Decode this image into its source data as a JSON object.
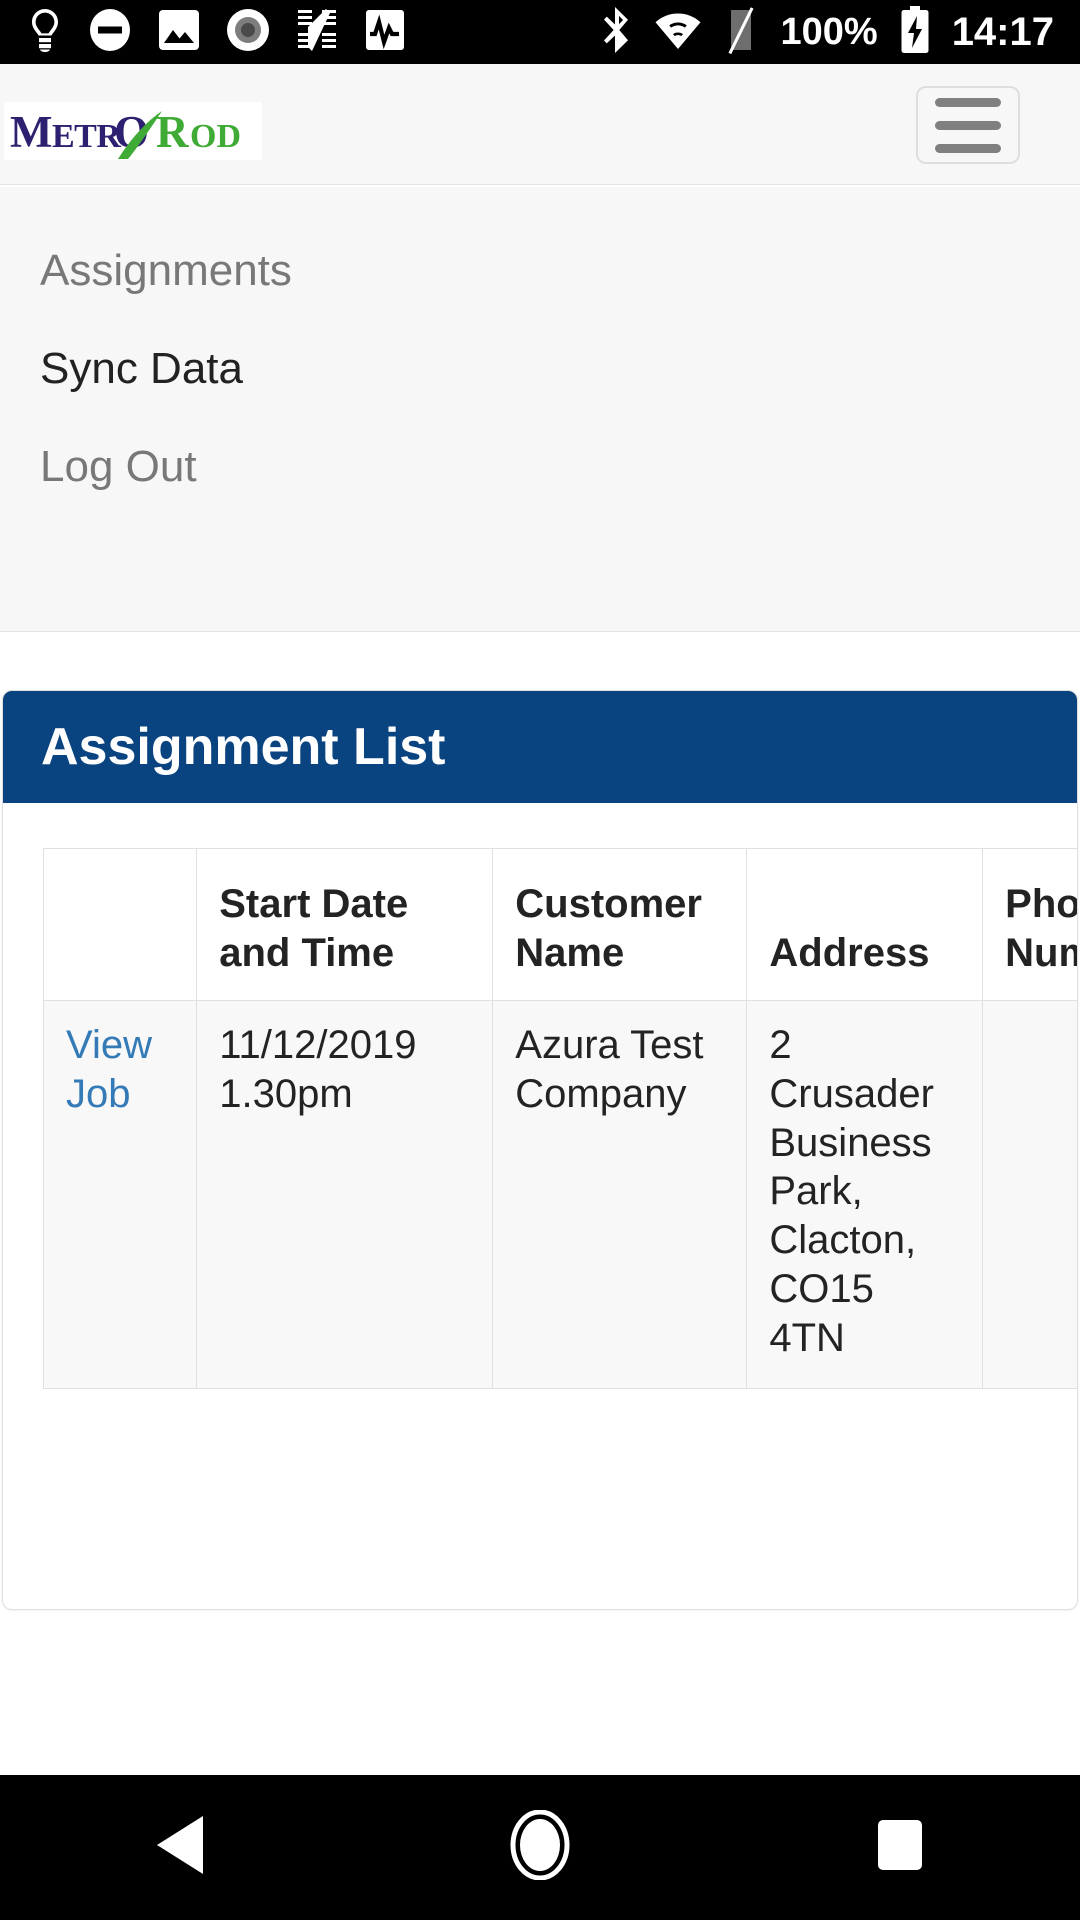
{
  "status_bar": {
    "left_icons": [
      "lightbulb-icon",
      "do-not-disturb-icon",
      "image-icon",
      "record-dot-icon",
      "screenshot-icon",
      "activity-pulse-icon"
    ],
    "right_icons": [
      "bluetooth-icon",
      "wifi-icon",
      "no-sim-icon",
      "battery-charging-icon"
    ],
    "battery": "100%",
    "clock": "14:17"
  },
  "app_header": {
    "logo_primary": "METRO",
    "logo_secondary": "ROD",
    "logo_primary_color": "#2d2070",
    "logo_secondary_color": "#3faa35",
    "menu_button_label": "menu"
  },
  "nav": {
    "items": [
      {
        "label": "Assignments",
        "state": "muted"
      },
      {
        "label": "Sync Data",
        "state": "active"
      },
      {
        "label": "Log Out",
        "state": "muted"
      }
    ]
  },
  "card": {
    "title": "Assignment List",
    "header_color": "#0a4480",
    "link_color": "#337ab7"
  },
  "table": {
    "columns": [
      "",
      "Start Date and Time",
      "Customer Name",
      "Address",
      "Phone Number"
    ],
    "rows": [
      {
        "action": "View Job",
        "start_date_and_time": "11/12/2019 1.30pm",
        "customer_name": "Azura Test Company",
        "address": "2 Crusader Business Park, Clacton, CO15 4TN",
        "phone_number": ""
      }
    ]
  },
  "system_nav": {
    "back": "back-button",
    "home": "home-button",
    "recents": "recents-button"
  }
}
